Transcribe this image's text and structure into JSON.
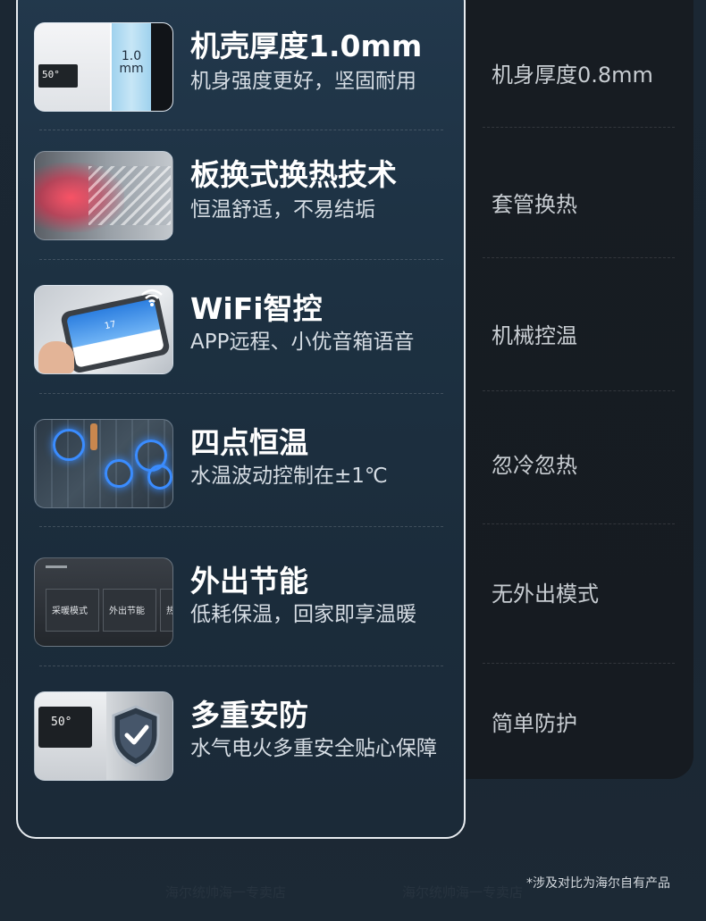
{
  "watermark": "海尔统帅海一专卖店",
  "features": [
    {
      "title": "机壳厚度1.0mm",
      "subtitle": "机身强度更好，坚固耐用",
      "thumb_label": "1.0 mm",
      "thumb_display": "50°"
    },
    {
      "title": "板换式换热技术",
      "subtitle": "恒温舒适，不易结垢"
    },
    {
      "title": "WiFi智控",
      "subtitle": "APP远程、小优音箱语音",
      "thumb_display": "17"
    },
    {
      "title": "四点恒温",
      "subtitle": "水温波动控制在±1℃"
    },
    {
      "title": "外出节能",
      "subtitle": "低耗保温，回家即享温暖",
      "thumb_buttons": [
        "采暖模式",
        "外出节能",
        "热"
      ]
    },
    {
      "title": "多重安防",
      "subtitle": "水气电火多重安全贴心保障",
      "thumb_display": "50°"
    }
  ],
  "comparison": [
    "机身厚度0.8mm",
    "套管换热",
    "机械控温",
    "忽冷忽热",
    "无外出模式",
    "简单防护"
  ],
  "footnote": "*涉及对比为海尔自有产品"
}
